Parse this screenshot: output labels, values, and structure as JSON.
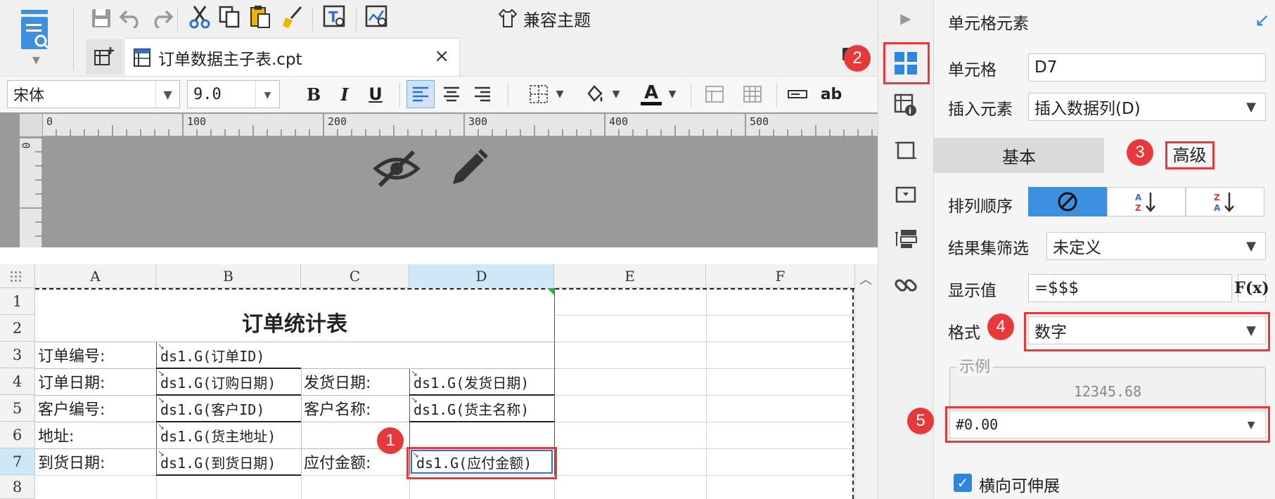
{
  "toolbar": {
    "compat_theme_label": "兼容主题",
    "icons": [
      "save-icon",
      "undo-icon",
      "redo-icon",
      "cut-icon",
      "copy-icon",
      "paste-icon",
      "format-brush-icon",
      "text-search-icon",
      "chart-search-icon"
    ]
  },
  "tab": {
    "filename": "订单数据主子表.cpt",
    "close": "×"
  },
  "format_bar": {
    "font_family": "宋体",
    "font_size": "9.0",
    "bold": "B",
    "italic": "I",
    "underline": "U",
    "font_color_letter": "A",
    "text_label": "ab"
  },
  "ruler": {
    "marks": [
      "0",
      "100",
      "200",
      "300",
      "400",
      "500"
    ],
    "v_mark": "0"
  },
  "sheet": {
    "columns": [
      "A",
      "B",
      "C",
      "D",
      "E",
      "F"
    ],
    "rows": [
      "1",
      "2",
      "3",
      "4",
      "5",
      "6",
      "7",
      "8"
    ],
    "title": "订单统计表",
    "cells": {
      "a3": "订单编号:",
      "b3": "ds1.G(订单ID)",
      "a4": "订单日期:",
      "b4": "ds1.G(订购日期)",
      "c4": "发货日期:",
      "d4": "ds1.G(发货日期)",
      "a5": "客户编号:",
      "b5": "ds1.G(客户ID)",
      "c5": "客户名称:",
      "d5": "ds1.G(货主名称)",
      "a6": "地址:",
      "b6": "ds1.G(货主地址)",
      "a7": "到货日期:",
      "b7": "ds1.G(到货日期)",
      "c7": "应付金额:",
      "d7": "ds1.G(应付金额)"
    }
  },
  "callouts": [
    "1",
    "2",
    "3",
    "4",
    "5"
  ],
  "panel": {
    "title": "单元格元素",
    "cell_label": "单元格",
    "cell_value": "D7",
    "insert_label": "插入元素",
    "insert_value": "插入数据列(D)",
    "tab_basic": "基本",
    "tab_advanced": "高级",
    "sort_label": "排列顺序",
    "filter_label": "结果集筛选",
    "filter_value": "未定义",
    "display_label": "显示值",
    "display_value": "=$$$",
    "fx_label": "F(x)",
    "format_label": "格式",
    "format_value": "数字",
    "example_legend": "示例",
    "example_value": "12345.68",
    "pattern_value": "#0.00",
    "expand_label": "横向可伸展"
  },
  "colors": {
    "accent": "#3d8fe0",
    "callout_red": "#e8393a",
    "selected_col_header": "#cfe8f7"
  }
}
